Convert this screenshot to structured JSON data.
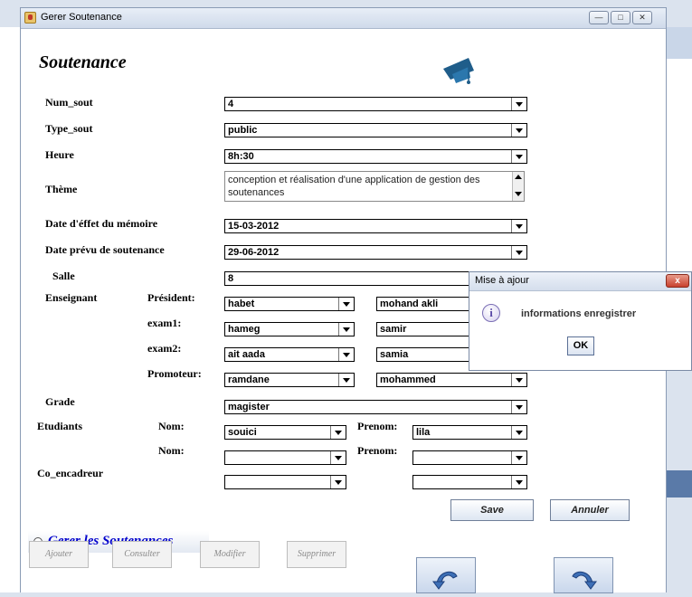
{
  "window": {
    "title": "Gerer Soutenance"
  },
  "form": {
    "heading": "Soutenance",
    "logo_text": "Soutenances",
    "labels": {
      "num_sout": "Num_sout",
      "type_sout": "Type_sout",
      "heure": "Heure",
      "theme": "Thème",
      "date_effet": "Date d'éffet du mémoire",
      "date_prevu": "Date prévu de soutenance",
      "salle": "Salle",
      "enseignant": "Enseignant",
      "president": "Président:",
      "exam1": "exam1:",
      "exam2": "exam2:",
      "promoteur": "Promoteur:",
      "grade": "Grade",
      "etudiants": "Etudiants",
      "nom1": "Nom:",
      "prenom1": "Prenom:",
      "nom2": "Nom:",
      "prenom2": "Prenom:",
      "co_encadreur": "Co_encadreur"
    },
    "values": {
      "num_sout": "4",
      "type_sout": "public",
      "heure": "8h:30",
      "theme": "conception et réalisation d'une application de gestion des soutenances",
      "date_effet": "15-03-2012",
      "date_prevu": "29-06-2012",
      "salle": "8",
      "president_nom": "habet",
      "president_prenom": "mohand akli",
      "exam1_nom": "hameg",
      "exam1_prenom": "samir",
      "exam2_nom": "ait aada",
      "exam2_prenom": "samia",
      "promoteur_nom": "ramdane",
      "promoteur_prenom": "mohammed",
      "grade": "magister",
      "etudiant1_nom": "souici",
      "etudiant1_prenom": "lila",
      "etudiant2_nom": "",
      "etudiant2_prenom": "",
      "co_encadreur_nom": "",
      "co_encadreur_prenom": ""
    },
    "buttons": {
      "save": "Save",
      "annuler": "Annuler"
    }
  },
  "gerer": {
    "radio_label": "Gerer les Soutenances",
    "ajouter": "Ajouter",
    "consulter": "Consulter",
    "modifier": "Modifier",
    "supprimer": "Supprimer"
  },
  "dialog": {
    "title": "Mise à ajour",
    "close": "x",
    "icon": "info-icon",
    "icon_glyph": "i",
    "message": "informations enregistrer",
    "ok": "OK"
  },
  "colors": {
    "accent_blue": "#0000cc",
    "logo_blue": "#1f5d8a",
    "close_red": "#c8402d"
  }
}
